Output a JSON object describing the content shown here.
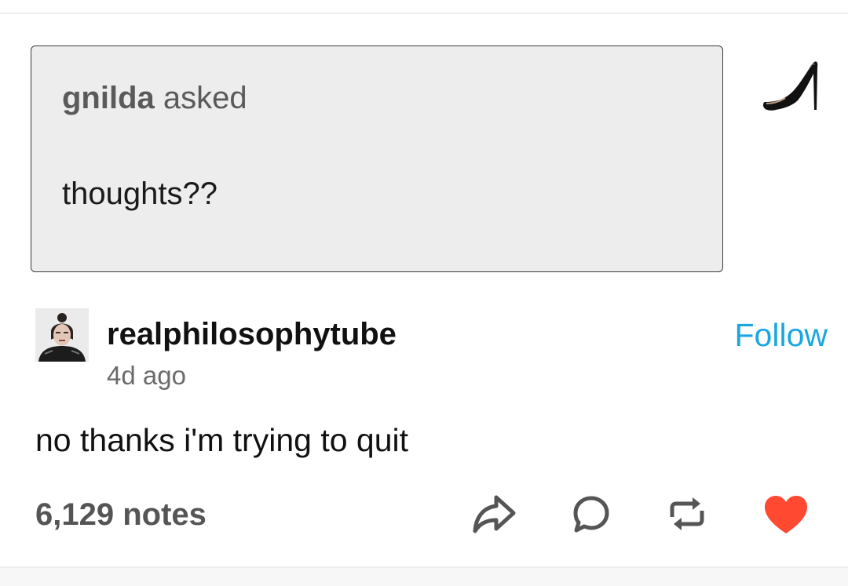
{
  "ask": {
    "asker": "gnilda",
    "verb": "asked",
    "question": "thoughts??",
    "asker_avatar_icon": "stiletto-heel-icon"
  },
  "answer": {
    "blog_name": "realphilosophytube",
    "time_ago": "4d ago",
    "follow_label": "Follow",
    "body": "no thanks i'm trying to quit"
  },
  "footer": {
    "notes": "6,129 notes",
    "actions": [
      "share-icon",
      "reply-icon",
      "reblog-icon",
      "like-icon"
    ]
  },
  "colors": {
    "follow": "#1aa7e0",
    "like": "#ff4930",
    "bubble_bg": "#ededed",
    "bubble_border": "#3a3a3a",
    "icon_gray": "#555555"
  }
}
